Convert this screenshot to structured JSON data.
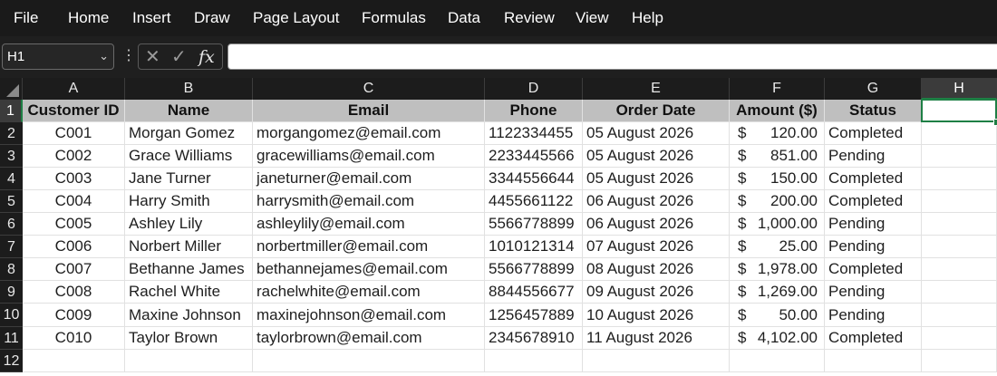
{
  "menu": [
    "File",
    "Home",
    "Insert",
    "Draw",
    "Page Layout",
    "Formulas",
    "Data",
    "Review",
    "View",
    "Help"
  ],
  "name_box": {
    "value": "H1",
    "caret": "⌄"
  },
  "formula_bar": {
    "cancel_icon": "✕",
    "enter_icon": "✓",
    "fx_label": "fx",
    "value": ""
  },
  "columns": [
    "A",
    "B",
    "C",
    "D",
    "E",
    "F",
    "G",
    "H"
  ],
  "selected_column": "H",
  "rows": [
    "1",
    "2",
    "3",
    "4",
    "5",
    "6",
    "7",
    "8",
    "9",
    "10",
    "11",
    "12"
  ],
  "selected_row": "1",
  "header": [
    "Customer ID",
    "Name",
    "Email",
    "Phone",
    "Order Date",
    "Amount ($)",
    "Status"
  ],
  "records": [
    {
      "id": "C001",
      "name": "Morgan Gomez",
      "email": "morgangomez@email.com",
      "phone": "1122334455",
      "date": "05 August 2026",
      "currency": "$",
      "amount": "120.00",
      "status": "Completed"
    },
    {
      "id": "C002",
      "name": "Grace Williams",
      "email": "gracewilliams@email.com",
      "phone": "2233445566",
      "date": "05 August 2026",
      "currency": "$",
      "amount": "851.00",
      "status": "Pending"
    },
    {
      "id": "C003",
      "name": "Jane Turner",
      "email": "janeturner@email.com",
      "phone": "3344556644",
      "date": "05 August 2026",
      "currency": "$",
      "amount": "150.00",
      "status": "Completed"
    },
    {
      "id": "C004",
      "name": "Harry Smith",
      "email": "harrysmith@email.com",
      "phone": "4455661122",
      "date": "06 August 2026",
      "currency": "$",
      "amount": "200.00",
      "status": "Completed"
    },
    {
      "id": "C005",
      "name": "Ashley Lily",
      "email": "ashleylily@email.com",
      "phone": "5566778899",
      "date": "06 August 2026",
      "currency": "$",
      "amount": "1,000.00",
      "status": "Pending"
    },
    {
      "id": "C006",
      "name": "Norbert Miller",
      "email": "norbertmiller@email.com",
      "phone": "1010121314",
      "date": "07 August 2026",
      "currency": "$",
      "amount": "25.00",
      "status": "Pending"
    },
    {
      "id": "C007",
      "name": "Bethanne James",
      "email": "bethannejames@email.com",
      "phone": "5566778899",
      "date": "08 August 2026",
      "currency": "$",
      "amount": "1,978.00",
      "status": "Completed"
    },
    {
      "id": "C008",
      "name": "Rachel White",
      "email": "rachelwhite@email.com",
      "phone": "8844556677",
      "date": "09 August 2026",
      "currency": "$",
      "amount": "1,269.00",
      "status": "Pending"
    },
    {
      "id": "C009",
      "name": "Maxine Johnson",
      "email": "maxinejohnson@email.com",
      "phone": "1256457889",
      "date": "10 August 2026",
      "currency": "$",
      "amount": "50.00",
      "status": "Pending"
    },
    {
      "id": "C010",
      "name": "Taylor Brown",
      "email": "taylorbrown@email.com",
      "phone": "2345678910",
      "date": "11 August 2026",
      "currency": "$",
      "amount": "4,102.00",
      "status": "Completed"
    }
  ],
  "colors": {
    "selection": "#1e7f45",
    "header_fill": "#bfbfbf",
    "chrome": "#1f1f1f"
  }
}
